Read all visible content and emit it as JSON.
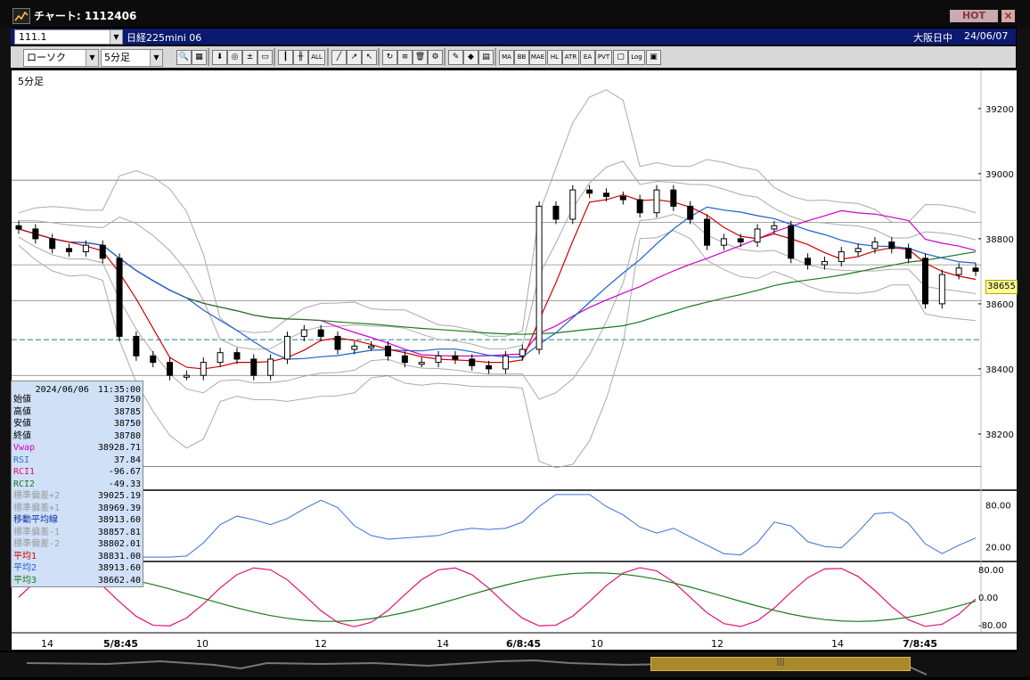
{
  "window": {
    "title": "チャート: 1112406",
    "hot_label": "HOT",
    "close_glyph": "✕"
  },
  "infobar": {
    "symbol_code": "111.1",
    "instrument": "日経225mini 06",
    "market": "大阪日中",
    "date": "24/06/07"
  },
  "toolbar": {
    "chart_type": "ローソク",
    "period": "5分足",
    "buttons": [
      "zoom-icon",
      "grid-icon",
      "down-arrow-icon",
      "target-icon",
      "fraction-icon",
      "memo-icon",
      "candle-icon",
      "bar-icon",
      "all-label",
      "draw-line-icon",
      "trend-icon",
      "cursor-icon",
      "rotate-icon",
      "note-icon",
      "trash-icon",
      "gear-icon",
      "brush-icon",
      "palette-icon",
      "vol-icon",
      "ma-label",
      "bb-label",
      "mae-label",
      "hl-label",
      "atr-label",
      "ea-label",
      "pvt-label",
      "window-icon",
      "log-label",
      "export-icon"
    ],
    "button_labels": {
      "all": "ALL",
      "ma": "MA",
      "bb": "BB",
      "mae": "MAE",
      "hl": "HL",
      "atr": "ATR",
      "ea": "EA",
      "pvt": "PVT",
      "log": "Log"
    }
  },
  "chart": {
    "period_label": "5分足",
    "current_price": "38655",
    "dashed_line_color": "#2c7d8a"
  },
  "chart_data": {
    "type": "line",
    "price_axis": {
      "ticks": [
        "39200",
        "39000",
        "38800",
        "38600",
        "38400",
        "38200"
      ],
      "ylim": [
        38030,
        39290
      ]
    },
    "osc1_axis": {
      "ticks": [
        "80.00",
        "20.00"
      ],
      "ylim": [
        0,
        100
      ]
    },
    "osc2_axis": {
      "ticks": [
        "80.00",
        "0.00",
        "-80.00"
      ],
      "ylim": [
        -100,
        100
      ]
    },
    "x_ticks": [
      "14",
      "5/8:45",
      "10",
      "12",
      "14",
      "6/8:45",
      "10",
      "12",
      "14",
      "7/8:45"
    ],
    "current_price": 38655,
    "dashed_level": 38490,
    "series": [
      {
        "name": "Vwap",
        "color": "#cc00cc"
      },
      {
        "name": "平均1",
        "color": "#d00000"
      },
      {
        "name": "平均2",
        "color": "#1e5fd0"
      },
      {
        "name": "平均3",
        "color": "#1a7a1a"
      },
      {
        "name": "RSI",
        "color": "#3a6fd8"
      },
      {
        "name": "RCI1",
        "color": "#e0107a"
      },
      {
        "name": "RCI2",
        "color": "#1a7a1a"
      }
    ],
    "close_path": [
      38830,
      38800,
      38770,
      38760,
      38780,
      38740,
      38500,
      38440,
      38420,
      38380,
      38380,
      38420,
      38450,
      38430,
      38380,
      38430,
      38500,
      38520,
      38500,
      38460,
      38470,
      38470,
      38440,
      38420,
      38420,
      38440,
      38430,
      38410,
      38400,
      38440,
      38460,
      38900,
      38860,
      38950,
      38940,
      38930,
      38920,
      38880,
      38950,
      38900,
      38860,
      38780,
      38800,
      38790,
      38830,
      38840,
      38740,
      38720,
      38730,
      38760,
      38770,
      38790,
      38770,
      38740,
      38600,
      38690,
      38710,
      38700
    ],
    "datawindow": {
      "timestamp": "2024/06/06　11:35:00",
      "rows": [
        {
          "label": "始値",
          "value": "38750",
          "color": "#000000"
        },
        {
          "label": "高値",
          "value": "38785",
          "color": "#000000"
        },
        {
          "label": "安値",
          "value": "38750",
          "color": "#000000"
        },
        {
          "label": "終値",
          "value": "38780",
          "color": "#000000"
        },
        {
          "label": "Vwap",
          "value": "38928.71",
          "color": "#cc00cc"
        },
        {
          "label": "RSI",
          "value": "37.84",
          "color": "#3a6fd8"
        },
        {
          "label": "RCI1",
          "value": "-96.67",
          "color": "#e0107a"
        },
        {
          "label": "RCI2",
          "value": "-49.33",
          "color": "#1a7a1a"
        },
        {
          "label": "標準偏差+2",
          "value": "39025.19",
          "color": "#999999"
        },
        {
          "label": "標準偏差+1",
          "value": "38969.39",
          "color": "#999999"
        },
        {
          "label": "移動平均線",
          "value": "38913.60",
          "color": "#1030a0"
        },
        {
          "label": "標準偏差-1",
          "value": "38857.81",
          "color": "#999999"
        },
        {
          "label": "標準偏差-2",
          "value": "38802.01",
          "color": "#999999"
        },
        {
          "label": "平均1",
          "value": "38831.00",
          "color": "#d00000"
        },
        {
          "label": "平均2",
          "value": "38913.60",
          "color": "#1e5fd0"
        },
        {
          "label": "平均3",
          "value": "38662.40",
          "color": "#1a7a1a"
        }
      ]
    }
  }
}
